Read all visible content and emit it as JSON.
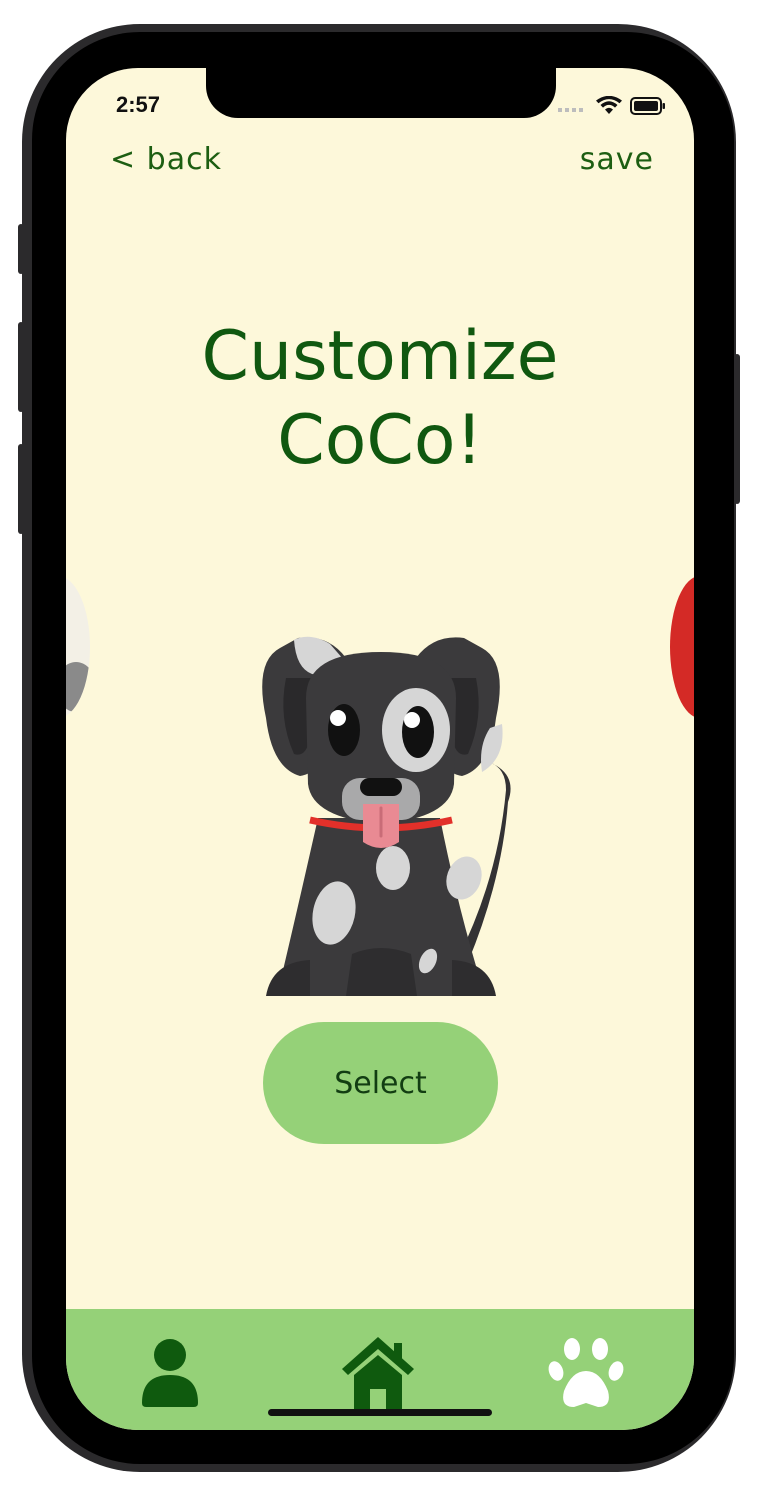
{
  "status_bar": {
    "time": "2:57",
    "icons": [
      "signal-icon",
      "wifi-icon",
      "battery-icon"
    ]
  },
  "nav": {
    "back_label": "< back",
    "save_label": "save"
  },
  "title": {
    "line1": "Customize",
    "line2": "CoCo!"
  },
  "carousel": {
    "items": [
      "white-spotted-dog",
      "black-spotted-dog",
      "red-dog"
    ],
    "selected_item": "black-spotted-dog"
  },
  "select_button": {
    "label": "Select"
  },
  "tab_bar": {
    "tabs": [
      "profile-icon",
      "home-icon",
      "paw-icon"
    ],
    "active": "home-icon"
  },
  "colors": {
    "background": "#fdf8da",
    "title_green": "#105810",
    "accent_green": "#95d178",
    "dark_green": "#0f5a0e",
    "dog_body": "#3b3a3c",
    "dog_spots": "#d6d6d6",
    "collar_red": "#e2302a",
    "tag_yellow": "#f3c419",
    "tongue_pink": "#e98a93"
  }
}
